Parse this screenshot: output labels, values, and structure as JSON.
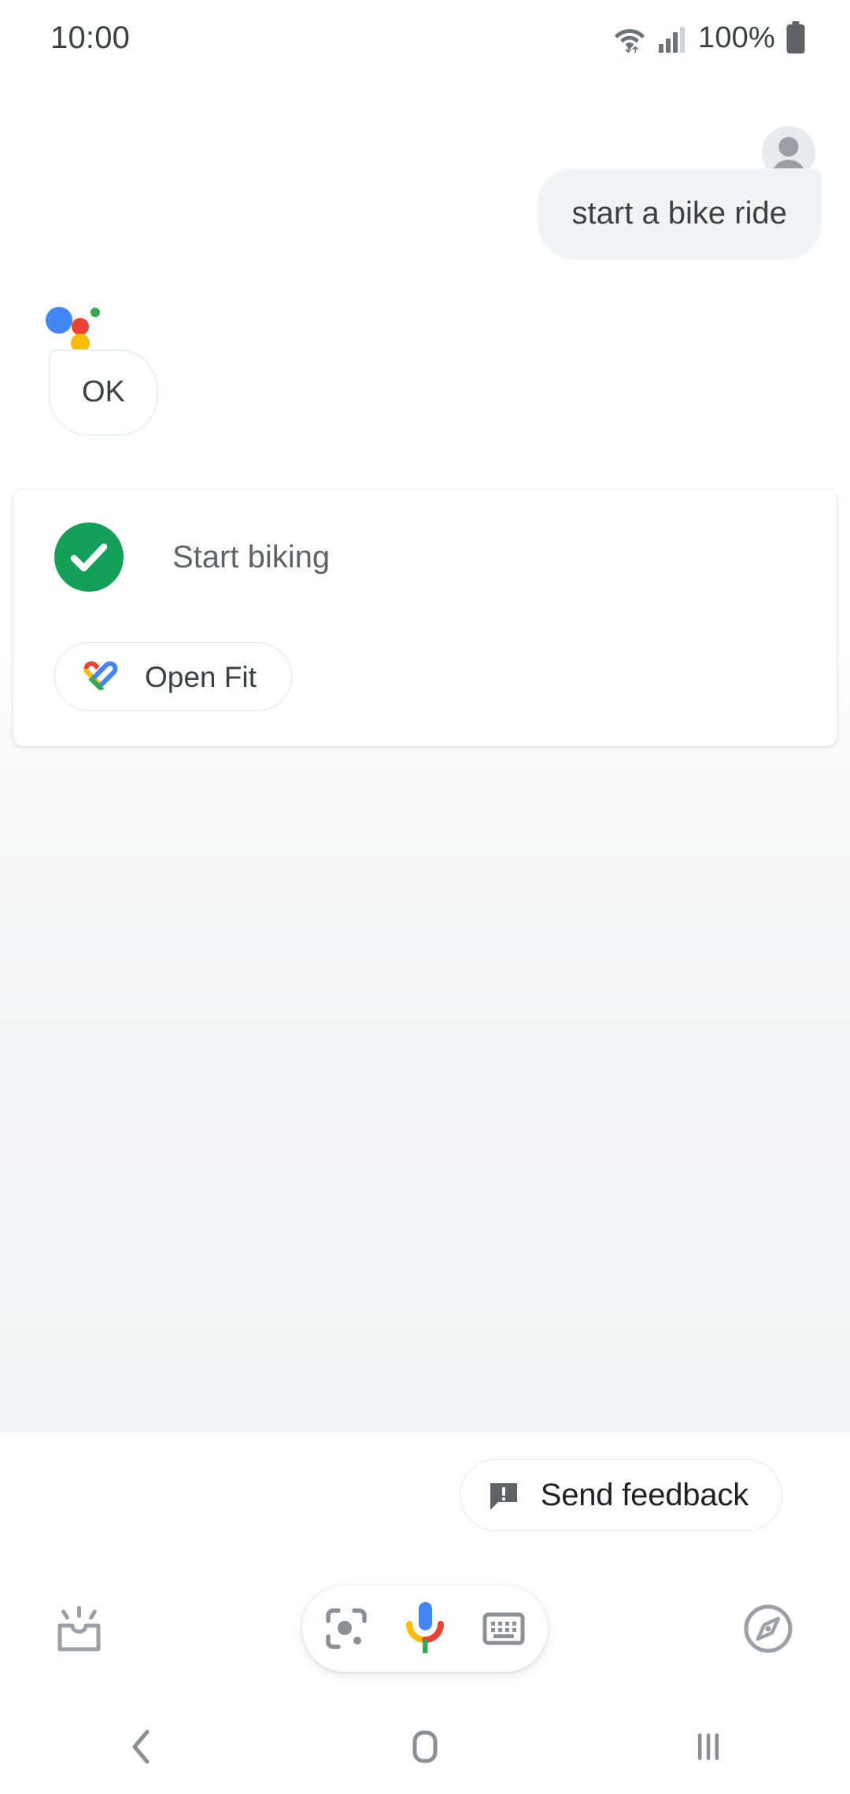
{
  "status_bar": {
    "clock": "10:00",
    "battery_text": "100%",
    "wifi_icon": "wifi-data-icon",
    "signal_icon": "cellular-signal-icon",
    "battery_icon": "battery-full-icon"
  },
  "conversation": {
    "user_turn": {
      "avatar_icon": "user-avatar-icon",
      "message": "start a bike ride"
    },
    "assistant_turn": {
      "logo_icon": "google-assistant-logo",
      "message": "OK"
    }
  },
  "result_card": {
    "status_icon": "check-circle-icon",
    "status_text": "Start biking",
    "action_chip": {
      "app_icon": "google-fit-icon",
      "label": "Open Fit"
    }
  },
  "feedback": {
    "icon": "feedback-bubble-icon",
    "label": "Send feedback"
  },
  "toolbar": {
    "snapshot_icon": "snapshot-updates-icon",
    "lens_icon": "google-lens-icon",
    "mic_icon": "google-microphone-icon",
    "keyboard_icon": "keyboard-icon",
    "explore_icon": "explore-compass-icon"
  },
  "navigation": {
    "back_icon": "back-chevron-icon",
    "home_icon": "home-square-icon",
    "recents_icon": "recents-bars-icon"
  },
  "colors": {
    "google_blue": "#4285f4",
    "google_red": "#ea4335",
    "google_yellow": "#fbbc04",
    "google_green": "#34a853",
    "success_green": "#15a05a",
    "bubble_gray": "#f1f3f4",
    "text_primary": "#3c4043",
    "text_secondary": "#5f6368",
    "icon_gray": "#9aa0a6"
  }
}
